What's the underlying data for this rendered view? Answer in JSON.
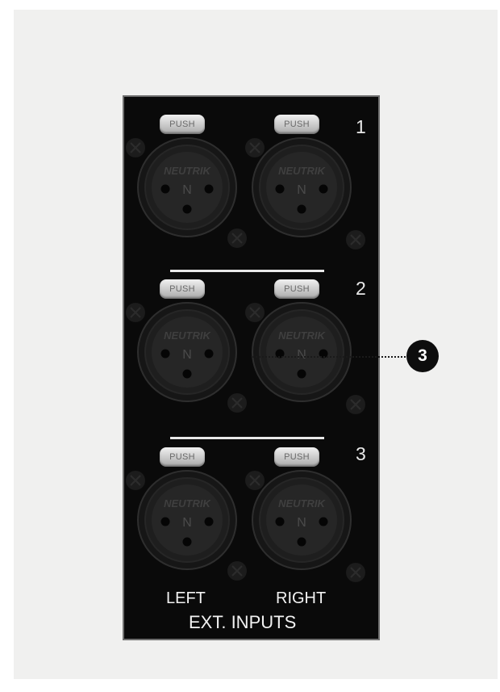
{
  "panel": {
    "rows": [
      {
        "number": "1",
        "left_push": "PUSH",
        "right_push": "PUSH"
      },
      {
        "number": "2",
        "left_push": "PUSH",
        "right_push": "PUSH"
      },
      {
        "number": "3",
        "left_push": "PUSH",
        "right_push": "PUSH"
      }
    ],
    "brand": "NEUTRIK",
    "logo_glyph": "N",
    "left_label": "LEFT",
    "right_label": "RIGHT",
    "footer_label": "EXT. INPUTS"
  },
  "callout": {
    "number": "3"
  },
  "colors": {
    "panel": "#0a0a0a",
    "panel_border": "#6e6e6e",
    "page_card": "#f0f0ef",
    "text": "#f2f2f2",
    "callout": "#0d0d0d"
  },
  "icons": [
    "xlr-connector-icon",
    "mounting-screw-icon",
    "push-latch-icon"
  ]
}
